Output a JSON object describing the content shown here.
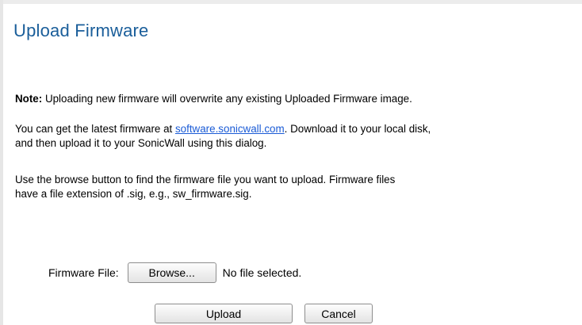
{
  "dialog": {
    "title": "Upload Firmware"
  },
  "note": {
    "label": "Note:",
    "text": " Uploading new firmware will overwrite any existing Uploaded Firmware image."
  },
  "latest": {
    "line1_prefix": "You can get the latest firmware at ",
    "link_text": "software.sonicwall.com",
    "line1_suffix": ". Download it to your local disk,",
    "line2": "and then upload it to your SonicWall using this dialog."
  },
  "browse_help": {
    "line1": "Use the browse button to find the firmware file you want to upload. Firmware files",
    "line2": "have a file extension of .sig, e.g., sw_firmware.sig."
  },
  "file_input": {
    "label": "Firmware File:",
    "browse_label": "Browse...",
    "status": "No file selected."
  },
  "actions": {
    "upload_label": "Upload",
    "cancel_label": "Cancel"
  },
  "colors": {
    "title": "#1a5e9a",
    "link": "#1a5bd6"
  }
}
